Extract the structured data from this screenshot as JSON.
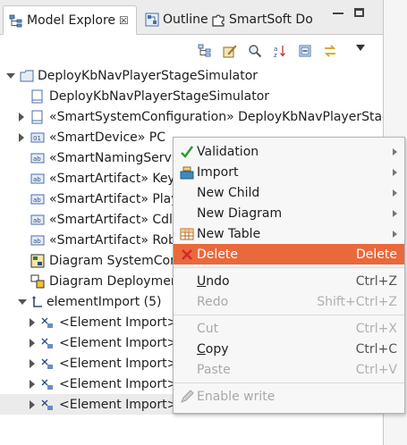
{
  "tabs": [
    {
      "label": "Model Explore",
      "active": true,
      "close": "☒"
    },
    {
      "label": "Outline"
    },
    {
      "label": "SmartSoft Do"
    }
  ],
  "toolbar_icons": [
    "link-tree-icon",
    "edit-icon",
    "search-icon",
    "sort-az-icon",
    "collapse-all-icon",
    "sync-icon"
  ],
  "tree": {
    "root": "DeployKbNavPlayerStageSimulator",
    "items": [
      {
        "label": "DeployKbNavPlayerStageSimulator"
      },
      {
        "label": "«SmartSystemConfiguration» DeployKbNavPlayerStag"
      },
      {
        "label": "«SmartDevice» PC"
      },
      {
        "label": "«SmartNamingServic"
      },
      {
        "label": "«SmartArtifact» Keyb"
      },
      {
        "label": "«SmartArtifact» Play"
      },
      {
        "label": "«SmartArtifact» CdlS"
      },
      {
        "label": "«SmartArtifact» Rob"
      },
      {
        "label": "Diagram SystemConfi"
      },
      {
        "label": "Diagram Deploymen"
      },
      {
        "label": "elementImport (5)"
      },
      {
        "label": "<Element Import> S"
      },
      {
        "label": "<Element Import> S"
      },
      {
        "label": "<Element Import> S"
      },
      {
        "label": "<Element Import> S"
      },
      {
        "label": "<Element Import> S"
      }
    ]
  },
  "menu": {
    "validation": "Validation",
    "import": "Import",
    "new_child": "New Child",
    "new_diagram": "New Diagram",
    "new_table": "New Table",
    "delete": "Delete",
    "delete_accel": "Delete",
    "undo": "Undo",
    "undo_accel": "Ctrl+Z",
    "redo": "Redo",
    "redo_accel": "Shift+Ctrl+Z",
    "cut": "Cut",
    "cut_accel": "Ctrl+X",
    "copy": "Copy",
    "copy_accel": "Ctrl+C",
    "paste": "Paste",
    "paste_accel": "Ctrl+V",
    "enable_write": "Enable write"
  },
  "colors": {
    "highlight": "#e9693c",
    "disabled": "#a8a8a8",
    "tree_icon_blue": "#4a6fa8"
  }
}
